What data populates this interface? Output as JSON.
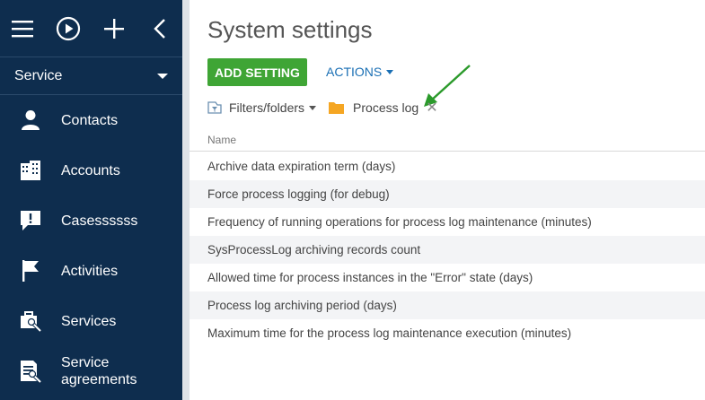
{
  "sidebar": {
    "workplace": "Service",
    "items": [
      {
        "label": "Contacts",
        "icon": "person-icon"
      },
      {
        "label": "Accounts",
        "icon": "building-icon"
      },
      {
        "label": "Casessssss",
        "icon": "case-icon"
      },
      {
        "label": "Activities",
        "icon": "flag-icon"
      },
      {
        "label": "Services",
        "icon": "services-icon"
      },
      {
        "label": "Service agreements",
        "icon": "agreement-icon"
      }
    ]
  },
  "main": {
    "title": "System settings",
    "add_button": "ADD SETTING",
    "actions_label": "ACTIONS",
    "filters_label": "Filters/folders",
    "folder_label": "Process log",
    "column_header": "Name",
    "rows": [
      "Archive data expiration term (days)",
      "Force process logging (for debug)",
      "Frequency of running operations for process log maintenance (minutes)",
      "SysProcessLog archiving records count",
      "Allowed time for process instances in the \"Error\" state (days)",
      "Process log archiving period (days)",
      "Maximum time for the process log maintenance execution (minutes)"
    ]
  },
  "colors": {
    "sidebar_bg": "#0e2d4e",
    "accent_green": "#3fa535",
    "link_blue": "#1a6fb4",
    "folder_orange": "#f5a623",
    "annotation_arrow": "#2b9a2b"
  }
}
